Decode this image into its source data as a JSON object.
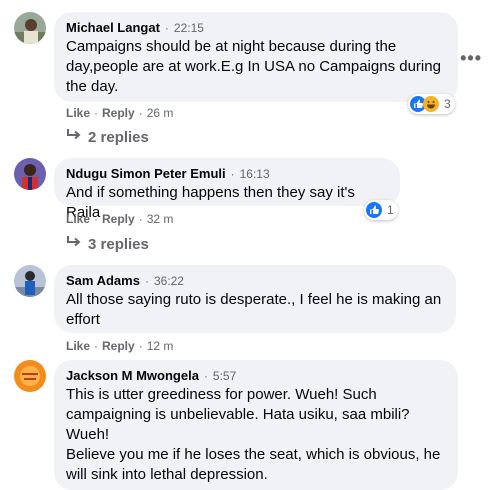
{
  "comments": [
    {
      "author": "Michael Langat",
      "time": "22:15",
      "text": "Campaigns should be at night because during the day,people are at work.E.g In USA no Campaigns during the day.",
      "like_label": "Like",
      "reply_label": "Reply",
      "age": "26 m",
      "reaction_count": "3",
      "reactions": [
        "like-icon",
        "haha-icon"
      ],
      "replies_label": "2 replies"
    },
    {
      "author": "Ndugu Simon Peter Emuli",
      "time": "16:13",
      "text": "And if something happens then they say it's Raila",
      "like_label": "Like",
      "reply_label": "Reply",
      "age": "32 m",
      "reaction_count": "1",
      "reactions": [
        "like-icon"
      ],
      "replies_label": "3 replies"
    },
    {
      "author": "Sam Adams",
      "time": "36:22",
      "text": "All those saying ruto is desperate., I feel he is making an effort",
      "like_label": "Like",
      "reply_label": "Reply",
      "age": "12 m"
    },
    {
      "author": "Jackson M Mwongela",
      "time": "5:57",
      "text_p1": "This is utter greediness for power. Wueh! Such campaigning is unbelievable. Hata usiku, saa mbili? Wueh!",
      "text_p2": "Believe you me if he loses the seat, which is obvious, he will sink into lethal depression."
    }
  ],
  "separator": "·",
  "colors": {
    "bubble": "#f0f2f5",
    "meta": "#65676b",
    "like_blue": "#1877f2",
    "haha_yellow": "#f7b125"
  },
  "more_icon": "more-options-icon"
}
